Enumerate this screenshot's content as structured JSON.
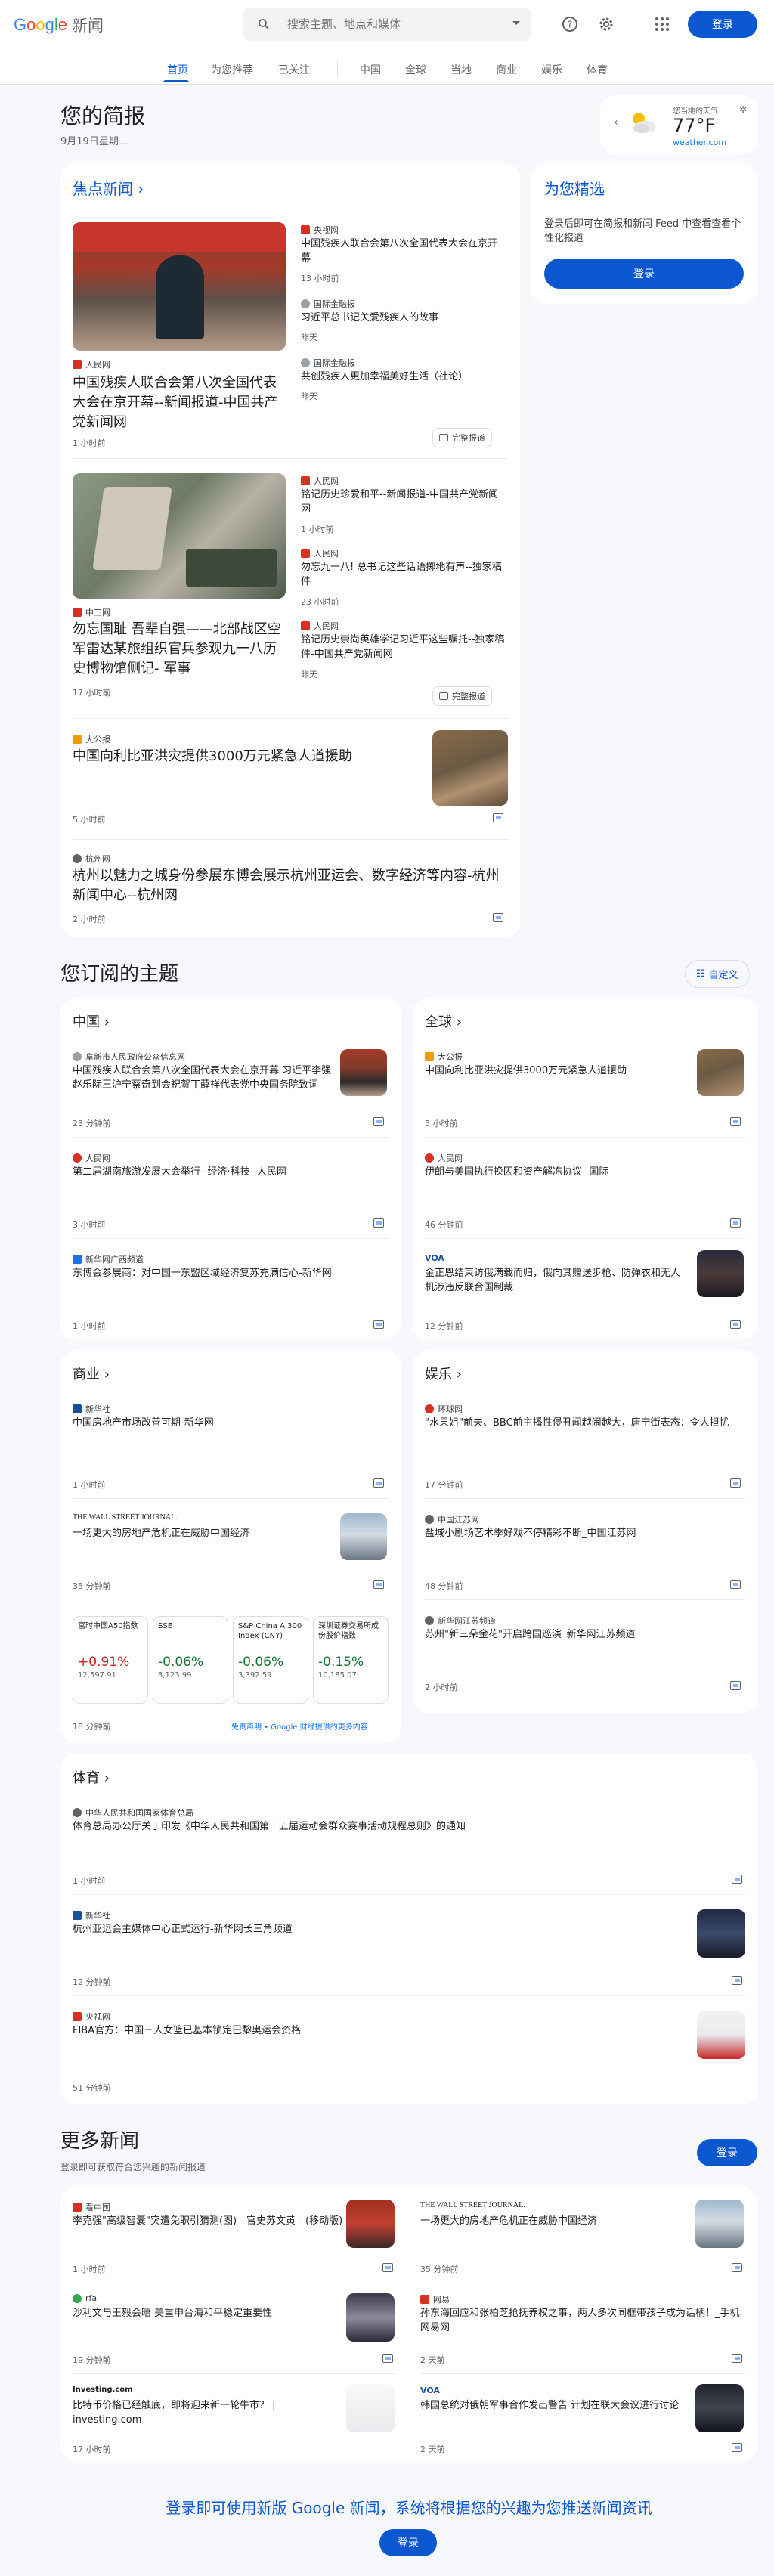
{
  "header": {
    "logo_google": "Google",
    "logo_news": "新闻",
    "search_placeholder": "搜索主题、地点和媒体",
    "signin": "登录"
  },
  "nav": {
    "tabs": [
      "首页",
      "为您推荐",
      "已关注",
      "中国",
      "全球",
      "当地",
      "商业",
      "娱乐",
      "体育"
    ]
  },
  "brief": {
    "title": "您的简报",
    "date": "9月19日星期二"
  },
  "weather": {
    "label": "您当地的天气",
    "temp": "77°F",
    "source": "weather.com"
  },
  "top": {
    "title": "焦点新闻",
    "cluster1": {
      "main_src": "人民网",
      "main_title": "中国残疾人联合会第八次全国代表大会在京开幕--新闻报道-中国共产党新闻网",
      "main_time": "1 小时前",
      "side": [
        {
          "src": "央视网",
          "title": "中国残疾人联合会第八次全国代表大会在京开幕",
          "time": "13 小时前"
        },
        {
          "src": "国际金融报",
          "title": "习近平总书记关爱残疾人的故事",
          "time": "昨天"
        },
        {
          "src": "国际金融报",
          "title": "共创残疾人更加幸福美好生活（社论）",
          "time": "昨天"
        }
      ],
      "full": "完整报道"
    },
    "cluster2": {
      "main_src": "中工网",
      "main_title": "勿忘国耻 吾辈自强——北部战区空军雷达某旅组织官兵参观九一八历史博物馆侧记- 军事",
      "main_time": "17 小时前",
      "side": [
        {
          "src": "人民网",
          "title": "铭记历史珍爱和平--新闻报道-中国共产党新闻网",
          "time": "1 小时前"
        },
        {
          "src": "人民网",
          "title": "勿忘九一八! 总书记这些话语掷地有声--独家稿件",
          "time": "23 小时前"
        },
        {
          "src": "人民网",
          "title": "铭记历史崇尚英雄学记习近平这些嘱托--独家稿件-中国共产党新闻网",
          "time": "昨天"
        }
      ],
      "full": "完整报道"
    },
    "item3": {
      "src": "大公报",
      "title": "中国向利比亚洪灾提供3000万元紧急人道援助",
      "time": "5 小时前"
    },
    "item4": {
      "src": "杭州网",
      "title": "杭州以魅力之城身份参展东博会展示杭州亚运会、数字经济等内容-杭州新闻中心--杭州网",
      "time": "2 小时前"
    }
  },
  "picks": {
    "title": "为您精选",
    "desc": "登录后即可在简报和新闻 Feed 中查看查看个性化报道",
    "signin": "登录"
  },
  "subs": {
    "title": "您订阅的主题",
    "customize": "自定义",
    "china": {
      "title": "中国",
      "items": [
        {
          "src": "阜新市人民政府公众信息网",
          "title": "中国残疾人联合会第八次全国代表大会在京开幕 习近平李强赵乐际王沪宁蔡奇到会祝贺丁薛祥代表党中央国务院致词",
          "time": "23 分钟前"
        },
        {
          "src": "人民网",
          "title": "第二届湖南旅游发展大会举行--经济·科技--人民网",
          "time": "3 小时前"
        },
        {
          "src": "新华网广西频道",
          "title": "东博会参展商：对中国一东盟区域经济复苏充满信心-新华网",
          "time": "1 小时前"
        }
      ]
    },
    "world": {
      "title": "全球",
      "items": [
        {
          "src": "大公报",
          "title": "中国向利比亚洪灾提供3000万元紧急人道援助",
          "time": "5 小时前"
        },
        {
          "src": "人民网",
          "title": "伊朗与美国执行换囚和资产解冻协议--国际",
          "time": "46 分钟前"
        },
        {
          "src": "VOA",
          "title": "金正恩结束访俄满载而归，俄向其赠送步枪、防弹衣和无人机涉违反联合国制裁",
          "time": "12 分钟前"
        }
      ]
    },
    "business": {
      "title": "商业",
      "items": [
        {
          "src": "新华社",
          "title": "中国房地产市场改善可期-新华网",
          "time": "1 小时前"
        },
        {
          "src": "THE WALL STREET JOURNAL.",
          "title": "一场更大的房地产危机正在威胁中国经济",
          "time": "35 分钟前"
        }
      ],
      "stocks": [
        {
          "name": "富时中国A50指数",
          "change": "+0.91%",
          "price": "12,597.91",
          "dir": "up"
        },
        {
          "name": "SSE",
          "change": "-0.06%",
          "price": "3,123.99",
          "dir": "down"
        },
        {
          "name": "S&P China A 300 Index (CNY)",
          "change": "-0.06%",
          "price": "3,392.59",
          "dir": "down"
        },
        {
          "name": "深圳证券交易所成份股价指数",
          "change": "-0.15%",
          "price": "10,185.07",
          "dir": "down"
        }
      ],
      "stock_time": "18 分钟前",
      "disclaimer": "免责声明 • Google 财经提供的更多内容"
    },
    "ent": {
      "title": "娱乐",
      "items": [
        {
          "src": "环球网",
          "title": "\"水果姐\"前夫、BBC前主播性侵丑闻越闹越大，唐宁街表态：令人担忧",
          "time": "17 分钟前"
        },
        {
          "src": "中国江苏网",
          "title": "盐城小剧场艺术季好戏不停精彩不断_中国江苏网",
          "time": "48 分钟前"
        },
        {
          "src": "新华网江苏频道",
          "title": "苏州\"新三朵金花\"开启跨国巡演_新华网江苏频道",
          "time": "2 小时前"
        }
      ]
    },
    "sports": {
      "title": "体育",
      "items": [
        {
          "src": "中华人民共和国国家体育总局",
          "title": "体育总局办公厅关于印发《中华人民共和国第十五届运动会群众赛事活动规程总则》的通知",
          "time": "1 小时前"
        },
        {
          "src": "新华社",
          "title": "杭州亚运会主媒体中心正式运行-新华网长三角频道",
          "time": "12 分钟前"
        },
        {
          "src": "央视网",
          "title": "FIBA官方：中国三人女篮已基本锁定巴黎奥运会资格",
          "time": "51 分钟前"
        }
      ]
    }
  },
  "more": {
    "title": "更多新闻",
    "desc": "登录即可获取符合您兴趣的新闻报道",
    "signin": "登录",
    "items": [
      {
        "src": "看中国",
        "title": "李克强\"高级智囊\"突遭免职引猜测(图) - 官史苏文黄 - (移动版)",
        "time": "1 小时前"
      },
      {
        "src": "THE WALL STREET JOURNAL.",
        "title": "一场更大的房地产危机正在威胁中国经济",
        "time": "35 分钟前"
      },
      {
        "src": "rfa",
        "title": "沙利文与王毅会晤 美重申台海和平稳定重要性",
        "time": "19 分钟前"
      },
      {
        "src": "网易",
        "title": "孙东海回应和张柏芝抢抚养权之事，两人多次同框带孩子成为话柄！_手机网易网",
        "time": "2 天前"
      },
      {
        "src": "Investing.com",
        "title": "比特币价格已经触底，即将迎来新一轮牛市？ | investing.com",
        "time": "17 小时前"
      },
      {
        "src": "VOA",
        "title": "韩国总统对俄朝军事合作发出警告 计划在联大会议进行讨论",
        "time": "2 天前"
      }
    ]
  },
  "footer": {
    "text": "登录即可使用新版 Google 新闻，系统将根据您的兴趣为您推送新闻资讯",
    "signin": "登录"
  }
}
